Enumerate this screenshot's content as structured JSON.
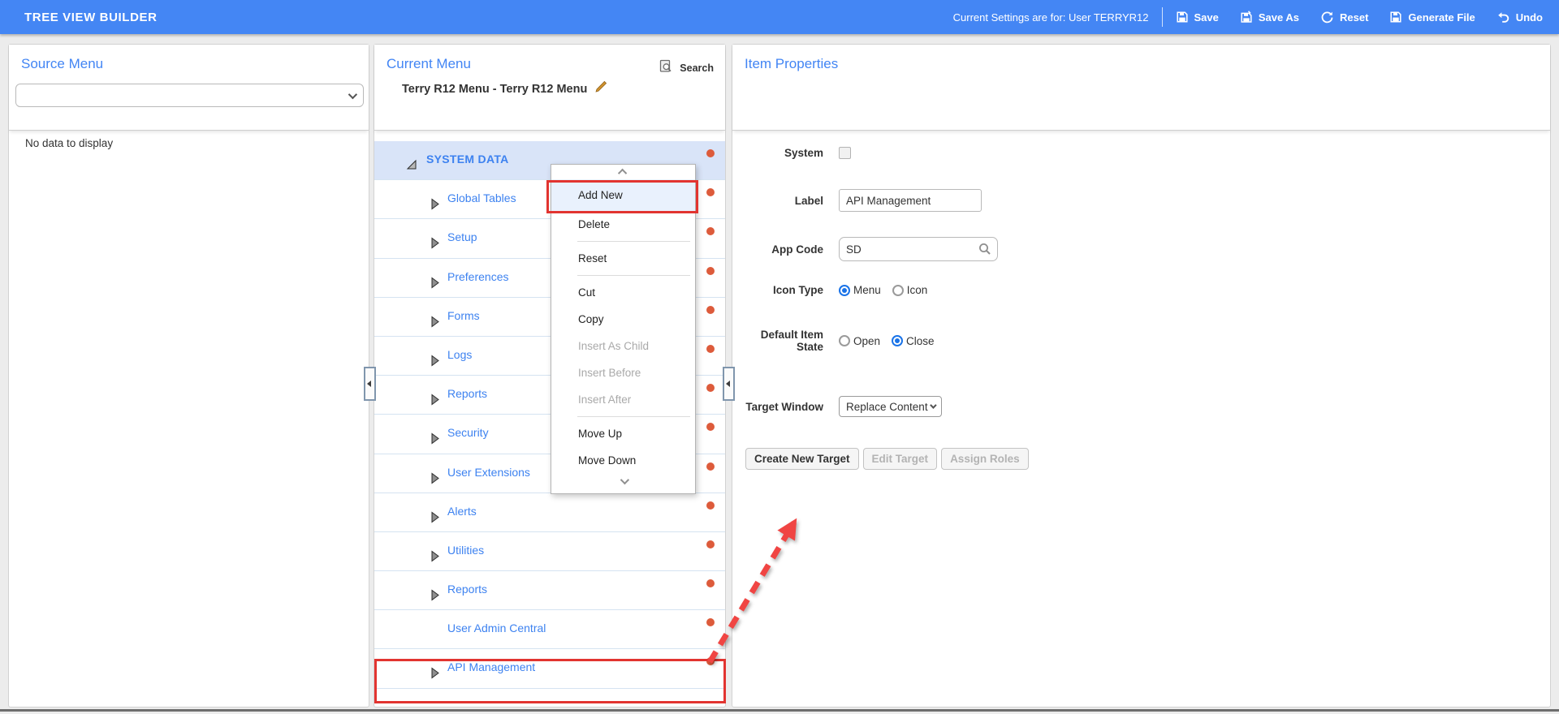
{
  "header": {
    "title": "TREE VIEW BUILDER",
    "settings_text": "Current Settings are for: User TERRYR12",
    "buttons": [
      {
        "label": "Save",
        "icon": "save-icon"
      },
      {
        "label": "Save As",
        "icon": "save-as-icon"
      },
      {
        "label": "Reset",
        "icon": "reset-icon"
      },
      {
        "label": "Generate File",
        "icon": "generate-file-icon"
      },
      {
        "label": "Undo",
        "icon": "undo-icon"
      }
    ]
  },
  "source_menu": {
    "title": "Source Menu",
    "dropdown_value": "",
    "empty_text": "No data to display"
  },
  "current_menu": {
    "title": "Current Menu",
    "menu_name": "Terry R12 Menu - Terry R12 Menu",
    "search_label": "Search",
    "tree": [
      {
        "label": "SYSTEM DATA",
        "state": "expanded",
        "level": 0,
        "selected": true
      },
      {
        "label": "Global Tables",
        "state": "collapsed",
        "level": 1
      },
      {
        "label": "Setup",
        "state": "collapsed",
        "level": 1
      },
      {
        "label": "Preferences",
        "state": "collapsed",
        "level": 1
      },
      {
        "label": "Forms",
        "state": "collapsed",
        "level": 1
      },
      {
        "label": "Logs",
        "state": "collapsed",
        "level": 1
      },
      {
        "label": "Reports",
        "state": "collapsed",
        "level": 1
      },
      {
        "label": "Security",
        "state": "collapsed",
        "level": 1
      },
      {
        "label": "User Extensions",
        "state": "collapsed",
        "level": 1
      },
      {
        "label": "Alerts",
        "state": "collapsed",
        "level": 1
      },
      {
        "label": "Utilities",
        "state": "collapsed",
        "level": 1
      },
      {
        "label": "Reports",
        "state": "collapsed",
        "level": 1
      },
      {
        "label": "User Admin Central",
        "state": "none",
        "level": 1
      },
      {
        "label": "API Management",
        "state": "collapsed",
        "level": 1,
        "annotated": true
      }
    ]
  },
  "context_menu": {
    "items": {
      "add_new": "Add New",
      "delete": "Delete",
      "reset": "Reset",
      "cut": "Cut",
      "copy": "Copy",
      "insert_as_child": "Insert As Child",
      "insert_before": "Insert Before",
      "insert_after": "Insert After",
      "move_up": "Move Up",
      "move_down": "Move Down"
    }
  },
  "item_properties": {
    "title": "Item Properties",
    "system_label": "System",
    "system_checked": false,
    "label_label": "Label",
    "label_value": "API Management",
    "app_code_label": "App Code",
    "app_code_value": "SD",
    "icon_type_label": "Icon Type",
    "icon_type_options": [
      "Menu",
      "Icon"
    ],
    "icon_type_selected": "Menu",
    "default_state_label": "Default Item State",
    "default_state_options": [
      "Open",
      "Close"
    ],
    "default_state_selected": "Close",
    "target_window_label": "Target Window",
    "target_window_value": "Replace Content",
    "buttons": [
      {
        "label": "Create New Target",
        "disabled": false
      },
      {
        "label": "Edit Target",
        "disabled": true
      },
      {
        "label": "Assign Roles",
        "disabled": true
      }
    ]
  },
  "colors": {
    "header_bg": "#4486f4",
    "accent_blue": "#4285f4",
    "tree_item_blue": "#3d82f0",
    "selected_row_bg": "#d9e4f8",
    "status_dot": "#dd5b3b",
    "annotation_red": "#e23430",
    "menu_highlight_bg": "#e9f1fd",
    "radio_selected": "#1a73e8"
  }
}
